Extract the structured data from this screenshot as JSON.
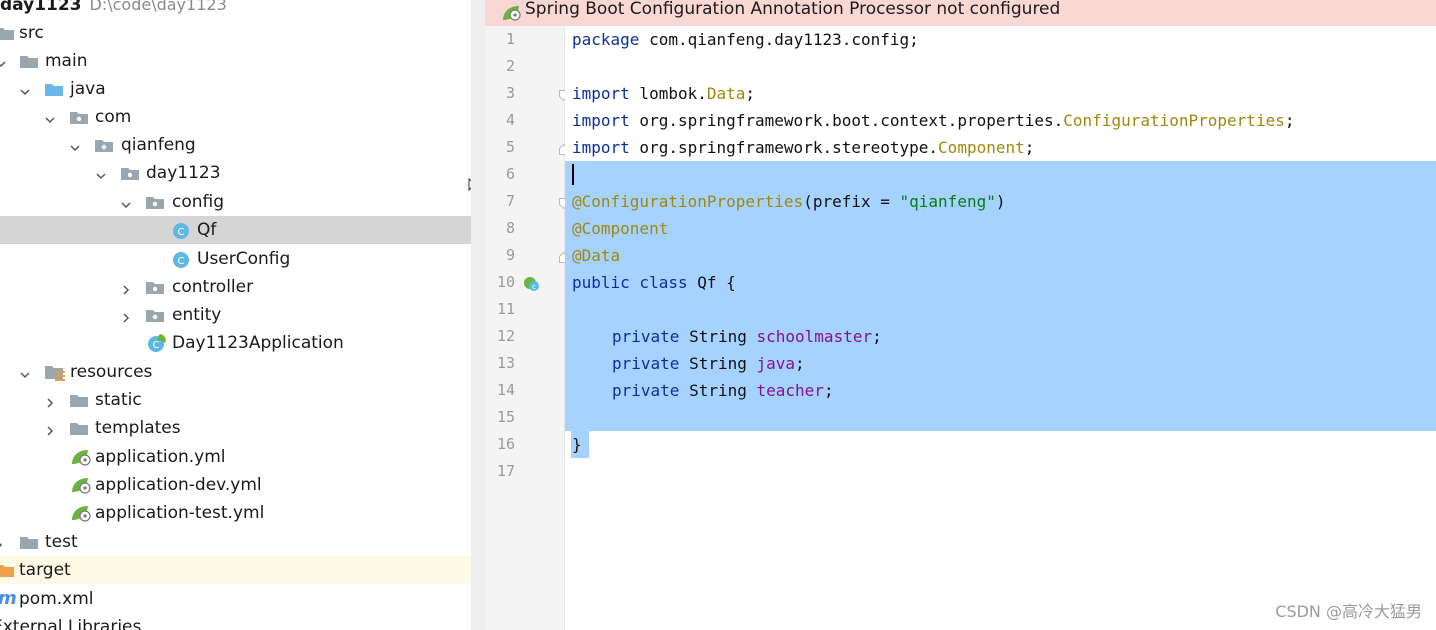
{
  "project_tree": {
    "root": {
      "label": "day1123",
      "path": "D:\\code\\day1123"
    },
    "items": [
      {
        "label": "src",
        "type": "folder"
      },
      {
        "label": "main",
        "type": "folder"
      },
      {
        "label": "java",
        "type": "source-folder"
      },
      {
        "label": "com",
        "type": "package"
      },
      {
        "label": "qianfeng",
        "type": "package"
      },
      {
        "label": "day1123",
        "type": "package"
      },
      {
        "label": "config",
        "type": "package"
      },
      {
        "label": "Qf",
        "type": "class",
        "selected": true
      },
      {
        "label": "UserConfig",
        "type": "class"
      },
      {
        "label": "controller",
        "type": "package"
      },
      {
        "label": "entity",
        "type": "package"
      },
      {
        "label": "Day1123Application",
        "type": "spring-class"
      },
      {
        "label": "resources",
        "type": "resources-folder"
      },
      {
        "label": "static",
        "type": "folder"
      },
      {
        "label": "templates",
        "type": "folder"
      },
      {
        "label": "application.yml",
        "type": "spring-yml"
      },
      {
        "label": "application-dev.yml",
        "type": "spring-yml"
      },
      {
        "label": "application-test.yml",
        "type": "spring-yml"
      },
      {
        "label": "test",
        "type": "folder"
      },
      {
        "label": "target",
        "type": "excluded-folder"
      },
      {
        "label": "pom.xml",
        "type": "maven"
      },
      {
        "label": "External Libraries",
        "type": "libraries"
      }
    ]
  },
  "editor": {
    "banner": "Spring Boot Configuration Annotation Processor not configured",
    "line_numbers": [
      "1",
      "2",
      "3",
      "4",
      "5",
      "6",
      "7",
      "8",
      "9",
      "10",
      "11",
      "12",
      "13",
      "14",
      "15",
      "16",
      "17"
    ],
    "code": {
      "l1": {
        "kw": "package",
        "rest": " com.qianfeng.day1123.config;"
      },
      "l3": {
        "kw": "import",
        "pkg": " lombok.",
        "cls": "Data",
        "end": ";"
      },
      "l4": {
        "kw": "import",
        "pkg": " org.springframework.boot.context.properties.",
        "cls": "ConfigurationProperties",
        "end": ";"
      },
      "l5": {
        "kw": "import",
        "pkg": " org.springframework.stereotype.",
        "cls": "Component",
        "end": ";"
      },
      "l7": {
        "ann": "@ConfigurationProperties",
        "open": "(prefix = ",
        "str": "\"qianfeng\"",
        "close": ")"
      },
      "l8": {
        "ann": "@Component"
      },
      "l9": {
        "ann": "@Data"
      },
      "l10": {
        "kw": "public class",
        "rest": " Qf {"
      },
      "l12": {
        "kw": "private",
        "type": " String ",
        "field": "schoolmaster",
        "end": ";"
      },
      "l13": {
        "kw": "private",
        "type": " String ",
        "field": "java",
        "end": ";"
      },
      "l14": {
        "kw": "private",
        "type": " String ",
        "field": "teacher",
        "end": ";"
      },
      "l16": {
        "text": "}"
      }
    },
    "selection_color": "#a6d2ff",
    "banner_color": "#f9d7d3"
  },
  "watermark": "CSDN @高冷大猛男"
}
